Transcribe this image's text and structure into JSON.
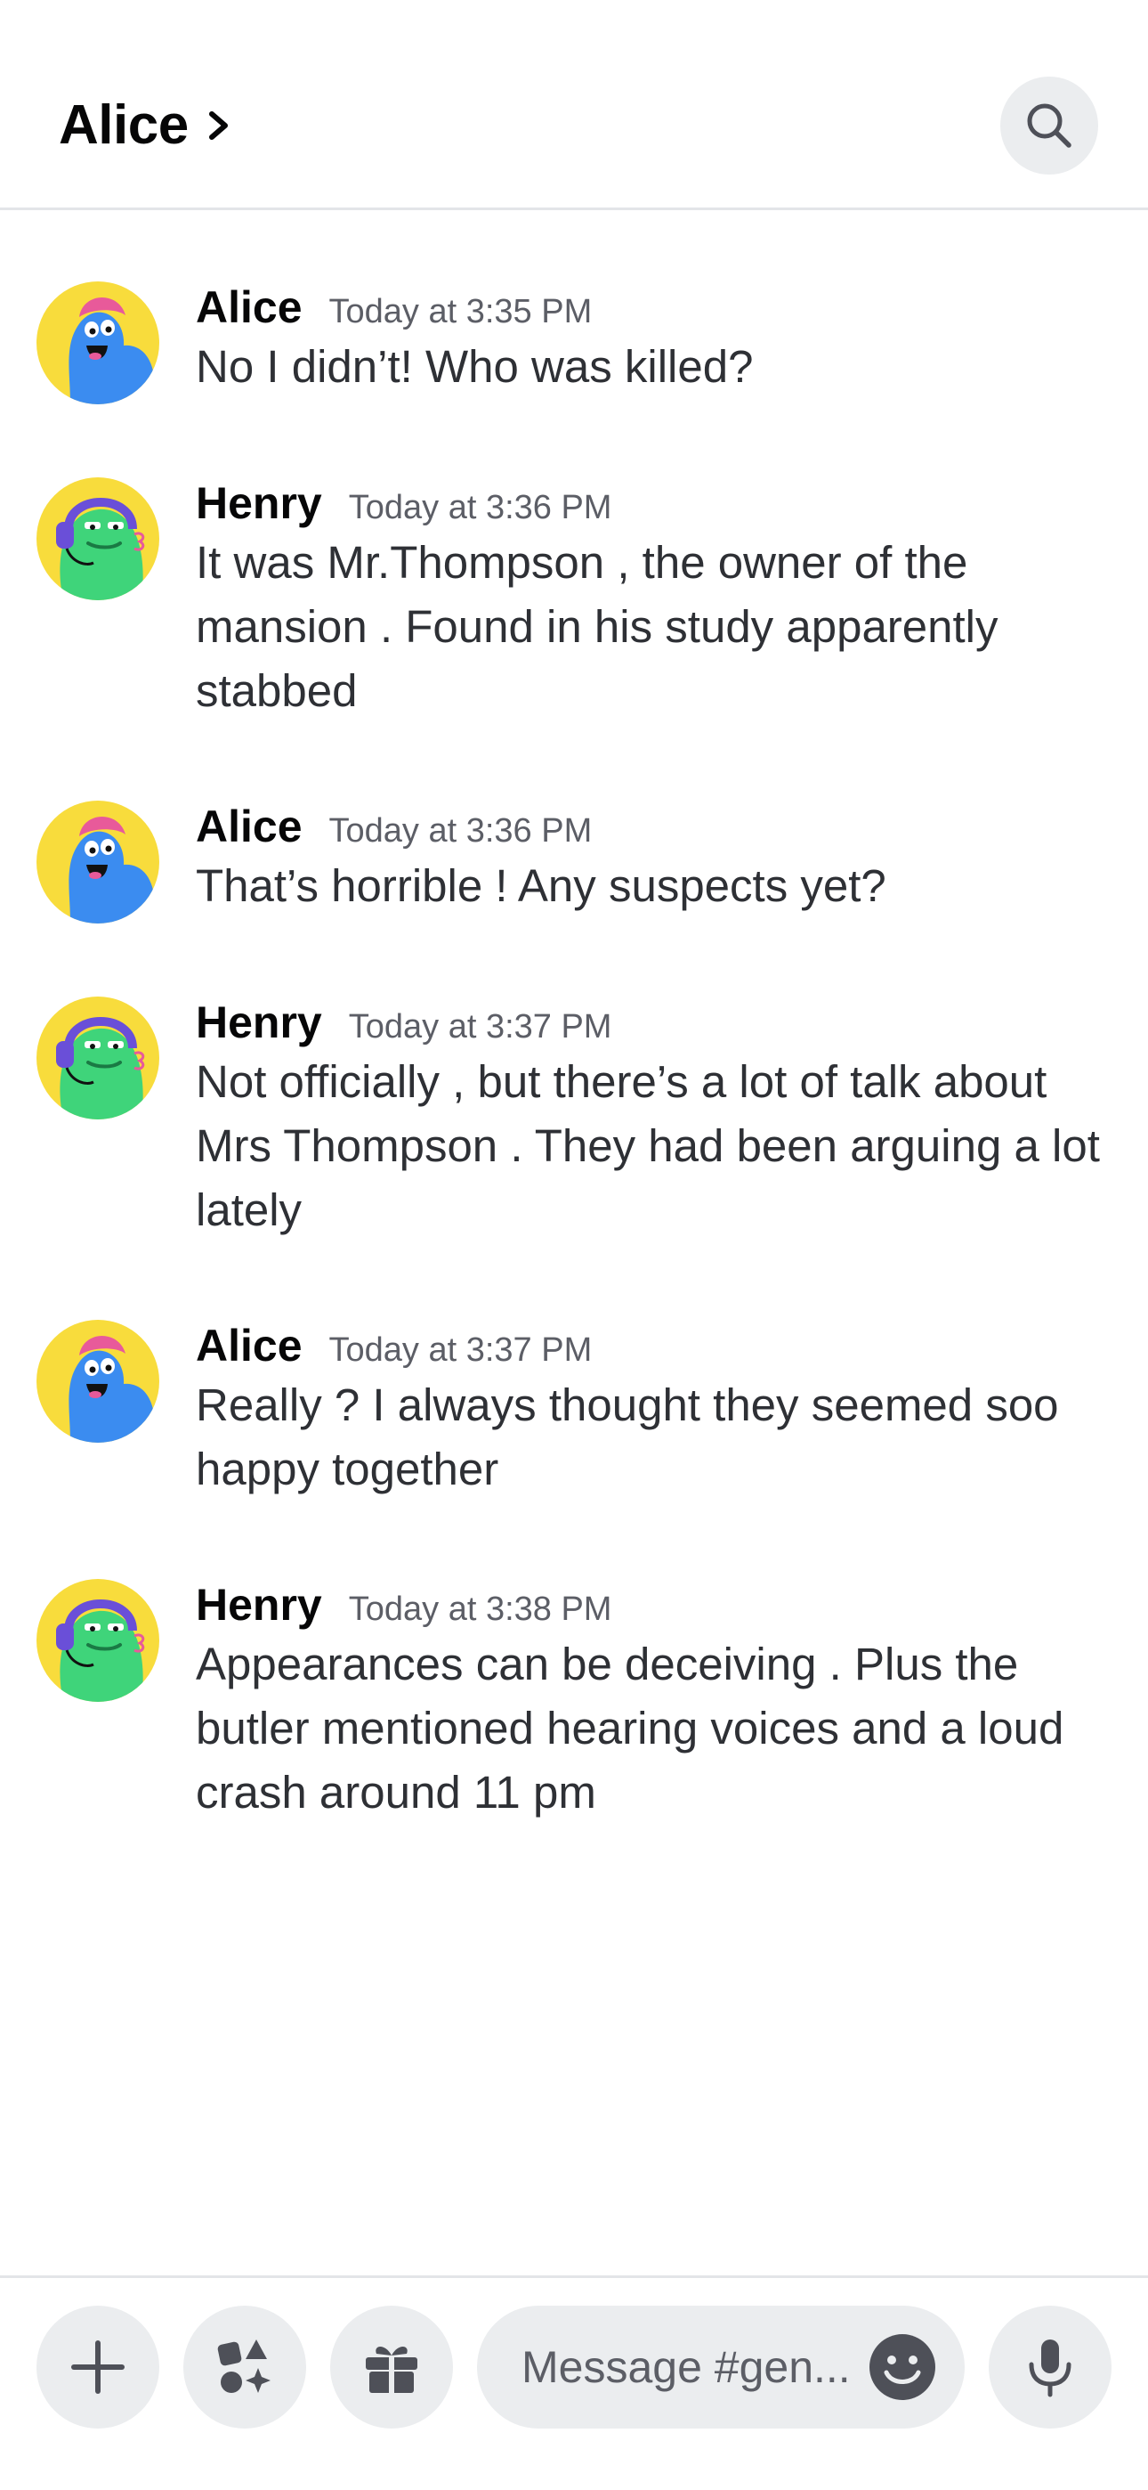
{
  "header": {
    "title": "Alice",
    "chevron_icon": "chevron-right-icon",
    "search_icon": "search-icon"
  },
  "messages": [
    {
      "author": "Alice",
      "timestamp": "Today at 3:35 PM",
      "text": "No I didn’t! Who was killed?",
      "avatar": "alice-avatar"
    },
    {
      "author": "Henry",
      "timestamp": "Today at 3:36 PM",
      "text": "It was Mr.Thompson , the owner of the mansion . Found in his study apparently stabbed",
      "avatar": "henry-avatar"
    },
    {
      "author": "Alice",
      "timestamp": "Today at 3:36 PM",
      "text": "That’s horrible ! Any suspects yet?",
      "avatar": "alice-avatar"
    },
    {
      "author": "Henry",
      "timestamp": "Today at 3:37 PM",
      "text": "Not officially , but there’s a lot of talk about Mrs Thompson . They had been arguing a lot lately",
      "avatar": "henry-avatar"
    },
    {
      "author": "Alice",
      "timestamp": "Today at 3:37 PM",
      "text": "Really ? I always thought they seemed soo happy together",
      "avatar": "alice-avatar"
    },
    {
      "author": "Henry",
      "timestamp": "Today at 3:38 PM",
      "text": "Appearances can be deceiving . Plus the butler mentioned hearing voices and a loud crash around 11 pm",
      "avatar": "henry-avatar"
    }
  ],
  "composer": {
    "placeholder": "Message #gen...",
    "buttons": [
      "plus-icon",
      "apps-icon",
      "gift-icon",
      "emoji-icon",
      "microphone-icon"
    ]
  },
  "colors": {
    "avatar_bg": "#f8dc3c",
    "alice_body": "#3b8cf0",
    "henry_body": "#3fd47a",
    "button_bg": "#ebedef"
  }
}
